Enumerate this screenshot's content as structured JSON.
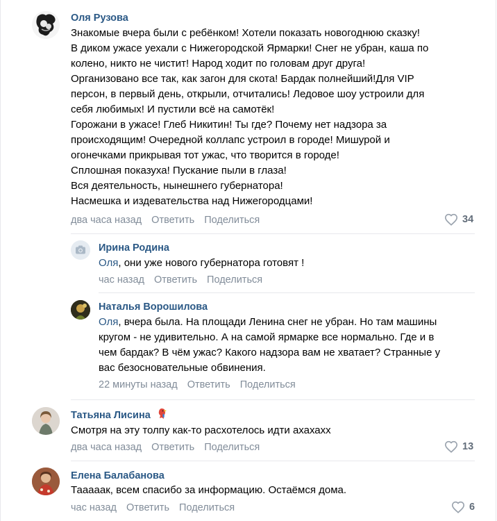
{
  "comments": [
    {
      "author": "Оля Рузова",
      "lines": [
        "Знакомые вчера были с ребёнком! Хотели показать новогоднюю сказку!",
        "В диком ужасе уехали с Нижегородской Ярмарки! Снег не убран, каша по",
        "колено, никто не чистит! Народ ходит по головам друг друга!",
        "Организовано все так, как загон для скота! Бардак полнейший!Для VIP",
        "персон, в первый день, открыли, отчитались! Ледовое шоу устроили для",
        "себя любимых! И пустили всё на самотёк!",
        "Горожани в ужасе! Глеб Никитин! Ты где? Почему нет надзора за",
        "происходящим! Очередной коллапс устроил в городе! Мишурой и",
        "огонечками прикрывая тот ужас, что творится в городе!",
        "Сплошная показуха! Пускание пыли в глаза!",
        "Вся деятельность, нынешнего губернатора!",
        "Насмешка и издевательства над Нижегородцами!"
      ],
      "time": "два часа назад",
      "reply": "Ответить",
      "share": "Поделиться",
      "likes": "34"
    },
    {
      "author": "Ирина Родина",
      "reply_to": "Оля",
      "lines": [
        ", они уже нового губернатора готовят !"
      ],
      "time": "час назад",
      "reply": "Ответить",
      "share": "Поделиться"
    },
    {
      "author": "Наталья Ворошилова",
      "reply_to": "Оля",
      "lines": [
        ", вчера была. На площади Ленина снег не убран. Но там машины",
        "кругом - не удивительно. А на самой ярмарке все нормально. Где и в",
        "чем бардак? В чём ужас? Какого надзора вам не хватает? Странные у",
        "вас безосновательные обвинения."
      ],
      "time": "22 минуты назад",
      "reply": "Ответить",
      "share": "Поделиться"
    },
    {
      "author": "Татьяна Лисина",
      "lines": [
        "Смотря на эту толпу как-то расхотелось идти ахахахх"
      ],
      "time": "два часа назад",
      "reply": "Ответить",
      "share": "Поделиться",
      "likes": "13"
    },
    {
      "author": "Елена Балабанова",
      "lines": [
        "Тааааак, всем спасибо за информацию. Остаёмся дома."
      ],
      "time": "час назад",
      "reply": "Ответить",
      "share": "Поделиться",
      "likes": "6"
    }
  ],
  "colors": {
    "author": "#2a5885",
    "meta": "#818c99",
    "like_count": "#626d7a",
    "separator": "#e7e8ec"
  },
  "icons": [
    "heart-icon",
    "camera-icon",
    "parrot-emoji-icon"
  ]
}
